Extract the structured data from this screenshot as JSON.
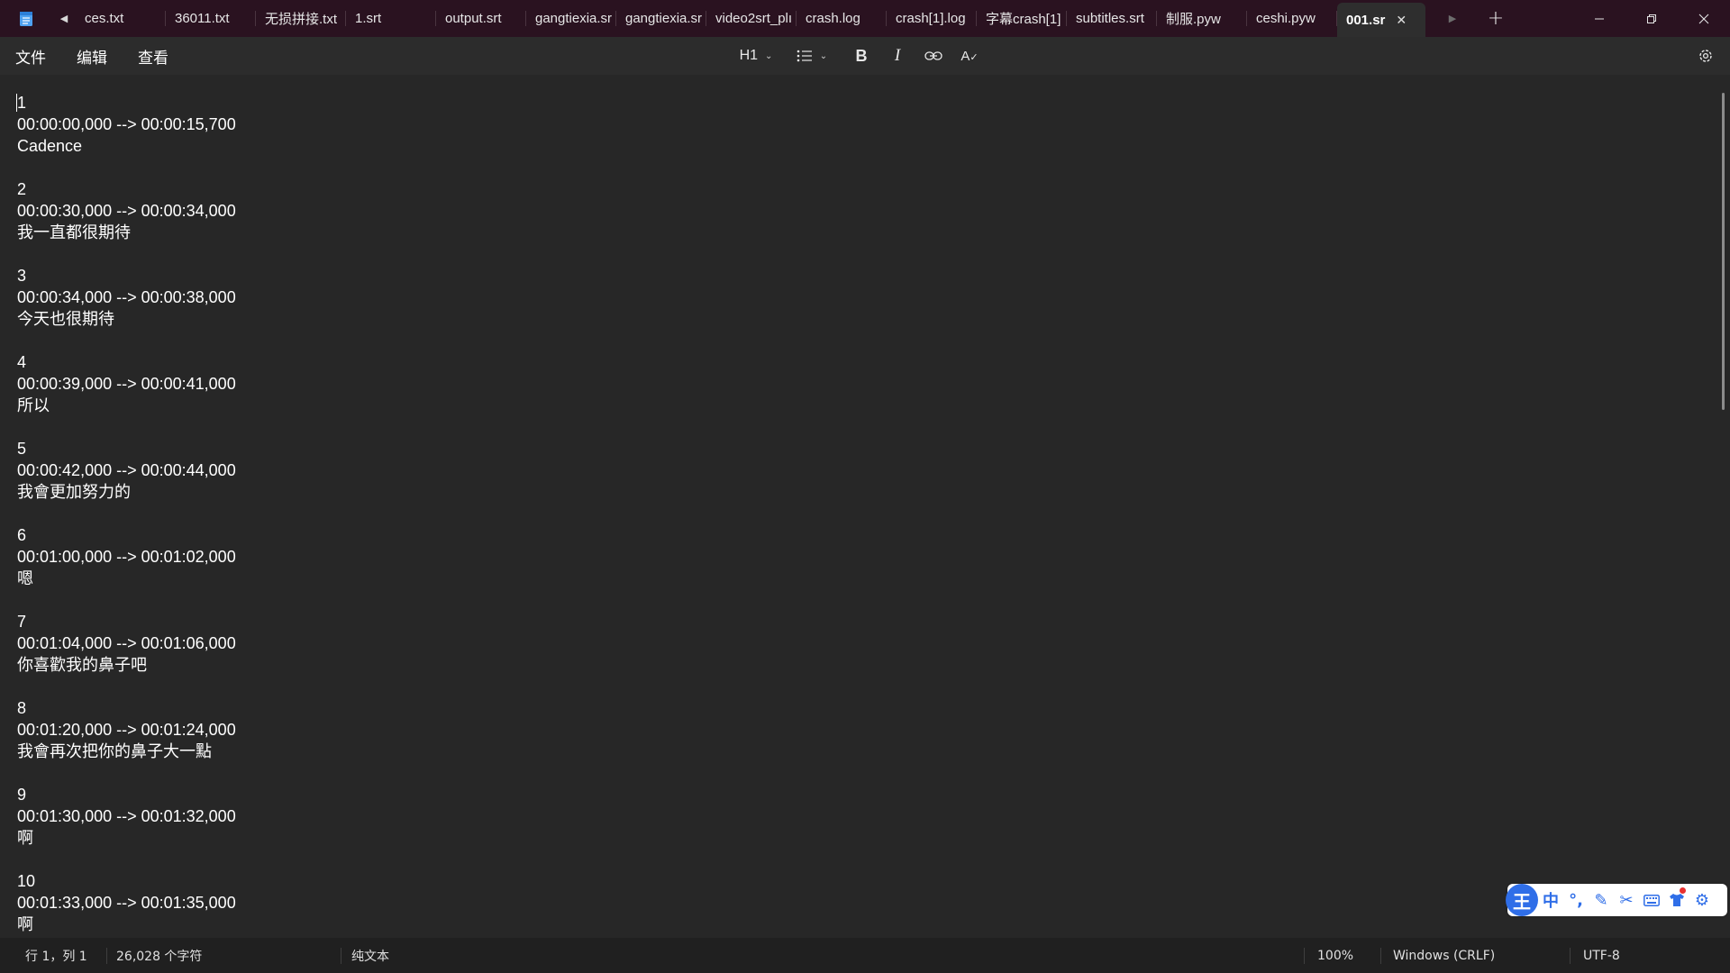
{
  "tabs": [
    {
      "label": "ces.txt"
    },
    {
      "label": "36011.txt"
    },
    {
      "label": "无损拼接.txt"
    },
    {
      "label": "1.srt"
    },
    {
      "label": "output.srt"
    },
    {
      "label": "gangtiexia.sr"
    },
    {
      "label": "gangtiexia.sr"
    },
    {
      "label": "video2srt_plı"
    },
    {
      "label": "crash.log"
    },
    {
      "label": "crash[1].log"
    },
    {
      "label": "字幕crash[1]"
    },
    {
      "label": "subtitles.srt"
    },
    {
      "label": "制服.pyw"
    },
    {
      "label": "ceshi.pyw"
    },
    {
      "label": "001.sr",
      "active": true
    }
  ],
  "menu": {
    "file": "文件",
    "edit": "编辑",
    "view": "查看"
  },
  "toolbar": {
    "heading": "H1",
    "bold": "B",
    "italic": "I",
    "spell": "A"
  },
  "editor": {
    "entries": [
      {
        "index": "1",
        "time": "00:00:00,000 --> 00:00:15,700",
        "text": "Cadence"
      },
      {
        "index": "2",
        "time": "00:00:30,000 --> 00:00:34,000",
        "text": "我一直都很期待"
      },
      {
        "index": "3",
        "time": "00:00:34,000 --> 00:00:38,000",
        "text": "今天也很期待"
      },
      {
        "index": "4",
        "time": "00:00:39,000 --> 00:00:41,000",
        "text": "所以"
      },
      {
        "index": "5",
        "time": "00:00:42,000 --> 00:00:44,000",
        "text": "我會更加努力的"
      },
      {
        "index": "6",
        "time": "00:01:00,000 --> 00:01:02,000",
        "text": "嗯"
      },
      {
        "index": "7",
        "time": "00:01:04,000 --> 00:01:06,000",
        "text": "你喜歡我的鼻子吧"
      },
      {
        "index": "8",
        "time": "00:01:20,000 --> 00:01:24,000",
        "text": "我會再次把你的鼻子大一點"
      },
      {
        "index": "9",
        "time": "00:01:30,000 --> 00:01:32,000",
        "text": "啊"
      },
      {
        "index": "10",
        "time": "00:01:33,000 --> 00:01:35,000",
        "text": "啊"
      }
    ]
  },
  "ime": {
    "logo": "王",
    "mode": "中",
    "punct": "°,"
  },
  "status": {
    "position": "行 1，列 1",
    "chars": "26,028 个字符",
    "format": "纯文本",
    "zoom": "100%",
    "line_ending": "Windows (CRLF)",
    "encoding": "UTF-8"
  },
  "colors": {
    "titlebar": "#2a1220",
    "editor_bg": "#272727",
    "ime_accent": "#2f6ee8"
  }
}
